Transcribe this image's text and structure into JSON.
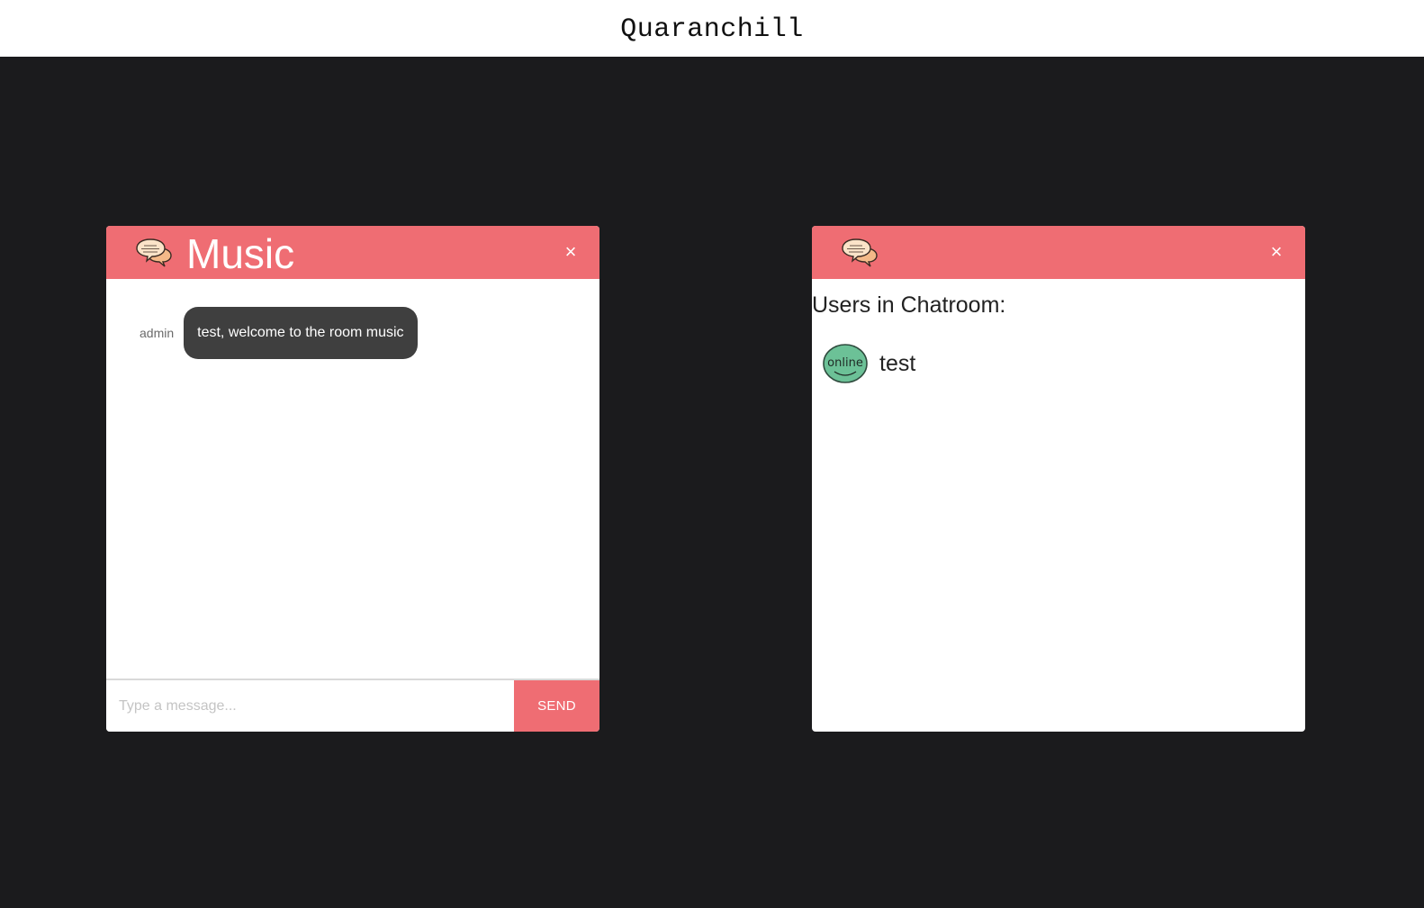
{
  "app": {
    "brand": "Quaranchill"
  },
  "chat_panel": {
    "title": "Music",
    "close_label": "×",
    "messages": [
      {
        "user": "admin",
        "text": "test, welcome to the room music"
      }
    ],
    "composer": {
      "placeholder": "Type a message...",
      "value": "",
      "send_label": "SEND"
    }
  },
  "users_panel": {
    "close_label": "×",
    "heading": "Users in Chatroom:",
    "users": [
      {
        "name": "test",
        "status_badge": "online"
      }
    ]
  },
  "colors": {
    "accent": "#ef6d73",
    "background": "#1b1b1d",
    "bubble": "#3f3f3f",
    "online": "#6cc197"
  },
  "icons": [
    "chat-bubbles-icon",
    "close-icon",
    "online-status-icon"
  ]
}
